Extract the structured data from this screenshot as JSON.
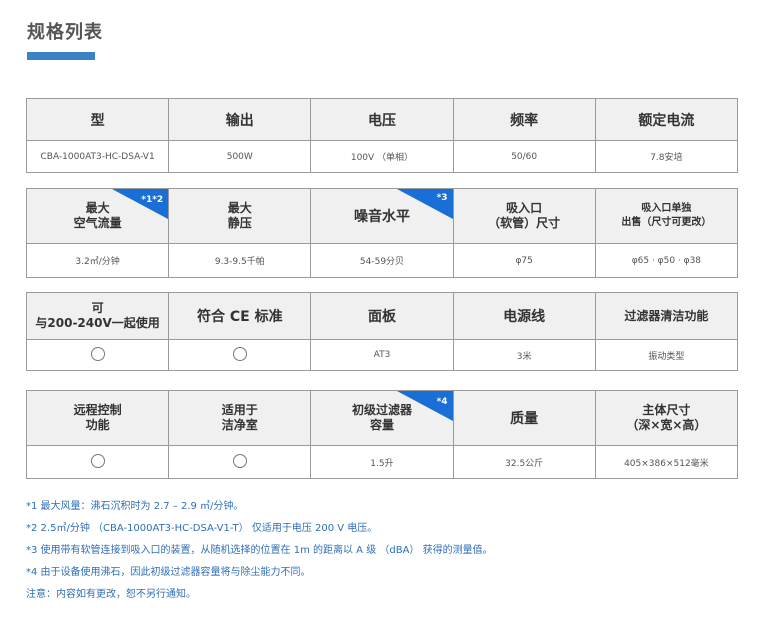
{
  "page": {
    "title": "规格列表"
  },
  "tables": [
    {
      "headers": [
        {
          "label": "型",
          "size": "big",
          "note": ""
        },
        {
          "label": "输出",
          "size": "big",
          "note": ""
        },
        {
          "label": "电压",
          "size": "big",
          "note": ""
        },
        {
          "label": "频率",
          "size": "big",
          "note": ""
        },
        {
          "label": "额定电流",
          "size": "big",
          "note": ""
        }
      ],
      "values": [
        "CBA-1000AT3-HC-DSA-V1",
        "500W",
        "100V （单相）",
        "50/60",
        "7.8安培"
      ]
    },
    {
      "headers": [
        {
          "label": "最大\n空气流量",
          "size": "mid",
          "note": "*1*2"
        },
        {
          "label": "最大\n静压",
          "size": "mid",
          "note": ""
        },
        {
          "label": "噪音水平",
          "size": "big",
          "note": "*3"
        },
        {
          "label": "吸入口\n（软管）尺寸",
          "size": "mid",
          "note": ""
        },
        {
          "label": "吸入口单独\n出售（尺寸可更改）",
          "size": "small",
          "note": ""
        }
      ],
      "values": [
        "3.2㎥/分钟",
        "9.3-9.5千帕",
        "54-59分贝",
        "φ75",
        "φ65 · φ50 · φ38"
      ]
    },
    {
      "headers": [
        {
          "label": "可\n与200-240V一起使用",
          "size": "mid",
          "note": ""
        },
        {
          "label": "符合 CE 标准",
          "size": "big",
          "note": ""
        },
        {
          "label": "面板",
          "size": "big",
          "note": ""
        },
        {
          "label": "电源线",
          "size": "big",
          "note": ""
        },
        {
          "label": "过滤器清洁功能",
          "size": "mid",
          "note": ""
        }
      ],
      "values": [
        "○",
        "○",
        "AT3",
        "3米",
        "振动类型"
      ]
    },
    {
      "headers": [
        {
          "label": "远程控制\n功能",
          "size": "mid",
          "note": ""
        },
        {
          "label": "适用于\n洁净室",
          "size": "mid",
          "note": ""
        },
        {
          "label": "初级过滤器\n容量",
          "size": "mid",
          "note": "*4"
        },
        {
          "label": "质量",
          "size": "big",
          "note": ""
        },
        {
          "label": "主体尺寸\n（深×宽×高）",
          "size": "mid",
          "note": ""
        }
      ],
      "values": [
        "○",
        "○",
        "1.5升",
        "32.5公斤",
        "405×386×512毫米"
      ]
    }
  ],
  "notes": [
    "*1 最大风量：沸石沉积时为 2.7 – 2.9 ㎥/分钟。",
    "*2 2.5㎥/分钟 （CBA-1000AT3-HC-DSA-V1-T） 仅适用于电压 200 V 电压。",
    "*3 使用带有软管连接到吸入口的装置，从随机选择的位置在 1m 的距离以 A 级 （dBA） 获得的测量值。",
    "*4 由于设备使用沸石，因此初级过滤器容量将与除尘能力不同。",
    "注意：内容如有更改，恕不另行通知。"
  ],
  "colors": {
    "accent": "#1a6fd6",
    "underline": "#3b82c4",
    "note_text": "#2f6fb7",
    "header_bg": "#f0f0f0"
  }
}
